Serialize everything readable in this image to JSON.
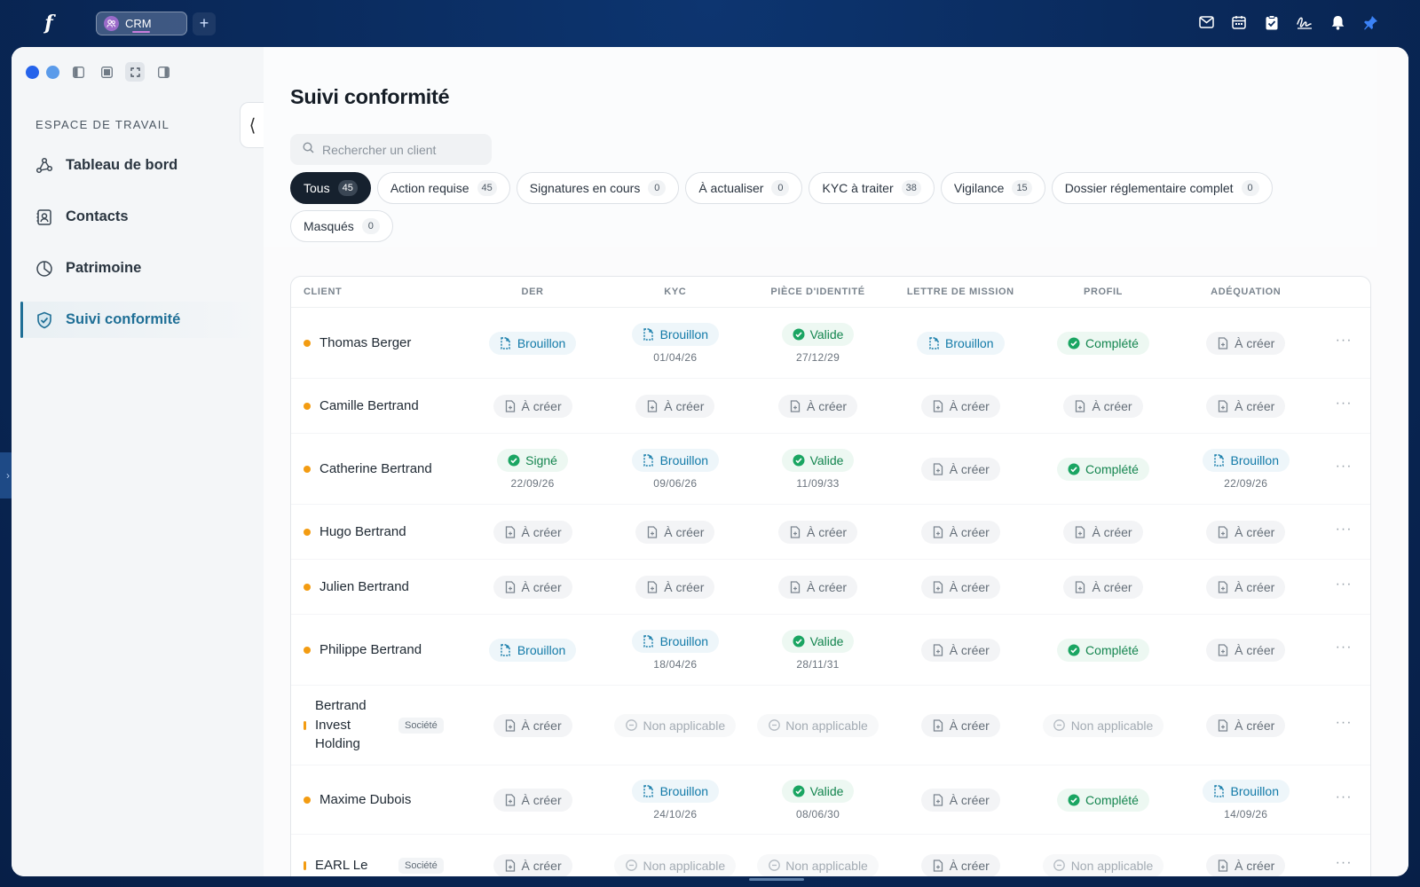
{
  "app": {
    "tab_label": "CRM",
    "add_tab": "+"
  },
  "colors": {
    "accent": "#1f6f96",
    "draft": "#127aa8",
    "valid": "#14854f",
    "warning_dot": "#f39c12",
    "window_dot_1": "#2563eb",
    "window_dot_2": "#5b9bea"
  },
  "topbar_icons": [
    "mail-icon",
    "calendar-icon",
    "clipboard-check-icon",
    "signature-icon",
    "bell-icon",
    "pin-icon"
  ],
  "sidebar": {
    "section_title": "ESPACE DE TRAVAIL",
    "collapse_glyph": "⟨",
    "items": [
      {
        "label": "Tableau de bord",
        "icon": "graph-icon"
      },
      {
        "label": "Contacts",
        "icon": "contacts-icon"
      },
      {
        "label": "Patrimoine",
        "icon": "pie-chart-icon"
      },
      {
        "label": "Suivi conformité",
        "icon": "shield-check-icon",
        "active": true
      }
    ]
  },
  "page": {
    "title": "Suivi conformité"
  },
  "search": {
    "placeholder": "Rechercher un client"
  },
  "filters": [
    {
      "label": "Tous",
      "count": "45",
      "active": true
    },
    {
      "label": "Action requise",
      "count": "45"
    },
    {
      "label": "Signatures en cours",
      "count": "0"
    },
    {
      "label": "À actualiser",
      "count": "0"
    },
    {
      "label": "KYC à traiter",
      "count": "38"
    },
    {
      "label": "Vigilance",
      "count": "15"
    },
    {
      "label": "Dossier réglementaire complet",
      "count": "0"
    },
    {
      "label": "Masqués",
      "count": "0"
    }
  ],
  "table": {
    "columns": [
      "CLIENT",
      "DER",
      "KYC",
      "PIÈCE D'IDENTITÉ",
      "LETTRE DE MISSION",
      "PROFIL",
      "ADÉQUATION"
    ],
    "rows": [
      {
        "client": "Thomas Berger",
        "cells": [
          [
            "draft",
            "Brouillon",
            ""
          ],
          [
            "draft",
            "Brouillon",
            "01/04/26"
          ],
          [
            "valid",
            "Valide",
            "27/12/29"
          ],
          [
            "draft",
            "Brouillon",
            ""
          ],
          [
            "valid",
            "Complété",
            ""
          ],
          [
            "create",
            "À créer",
            ""
          ]
        ]
      },
      {
        "client": "Camille Bertrand",
        "cells": [
          [
            "create",
            "À créer",
            ""
          ],
          [
            "create",
            "À créer",
            ""
          ],
          [
            "create",
            "À créer",
            ""
          ],
          [
            "create",
            "À créer",
            ""
          ],
          [
            "create",
            "À créer",
            ""
          ],
          [
            "create",
            "À créer",
            ""
          ]
        ]
      },
      {
        "client": "Catherine Bertrand",
        "cells": [
          [
            "valid",
            "Signé",
            "22/09/26"
          ],
          [
            "draft",
            "Brouillon",
            "09/06/26"
          ],
          [
            "valid",
            "Valide",
            "11/09/33"
          ],
          [
            "create",
            "À créer",
            ""
          ],
          [
            "valid",
            "Complété",
            ""
          ],
          [
            "draft",
            "Brouillon",
            "22/09/26"
          ]
        ]
      },
      {
        "client": "Hugo Bertrand",
        "cells": [
          [
            "create",
            "À créer",
            ""
          ],
          [
            "create",
            "À créer",
            ""
          ],
          [
            "create",
            "À créer",
            ""
          ],
          [
            "create",
            "À créer",
            ""
          ],
          [
            "create",
            "À créer",
            ""
          ],
          [
            "create",
            "À créer",
            ""
          ]
        ]
      },
      {
        "client": "Julien Bertrand",
        "cells": [
          [
            "create",
            "À créer",
            ""
          ],
          [
            "create",
            "À créer",
            ""
          ],
          [
            "create",
            "À créer",
            ""
          ],
          [
            "create",
            "À créer",
            ""
          ],
          [
            "create",
            "À créer",
            ""
          ],
          [
            "create",
            "À créer",
            ""
          ]
        ]
      },
      {
        "client": "Philippe Bertrand",
        "cells": [
          [
            "draft",
            "Brouillon",
            ""
          ],
          [
            "draft",
            "Brouillon",
            "18/04/26"
          ],
          [
            "valid",
            "Valide",
            "28/11/31"
          ],
          [
            "create",
            "À créer",
            ""
          ],
          [
            "valid",
            "Complété",
            ""
          ],
          [
            "create",
            "À créer",
            ""
          ]
        ]
      },
      {
        "client": "Bertrand Invest Holding",
        "tag": "Société",
        "cells": [
          [
            "create",
            "À créer",
            ""
          ],
          [
            "na",
            "Non applicable",
            ""
          ],
          [
            "na",
            "Non applicable",
            ""
          ],
          [
            "create",
            "À créer",
            ""
          ],
          [
            "na",
            "Non applicable",
            ""
          ],
          [
            "create",
            "À créer",
            ""
          ]
        ]
      },
      {
        "client": "Maxime Dubois",
        "cells": [
          [
            "create",
            "À créer",
            ""
          ],
          [
            "draft",
            "Brouillon",
            "24/10/26"
          ],
          [
            "valid",
            "Valide",
            "08/06/30"
          ],
          [
            "create",
            "À créer",
            ""
          ],
          [
            "valid",
            "Complété",
            ""
          ],
          [
            "draft",
            "Brouillon",
            "14/09/26"
          ]
        ]
      },
      {
        "client": "EARL Le",
        "tag": "Société",
        "cells": [
          [
            "create",
            "À créer",
            ""
          ],
          [
            "na",
            "Non applicable",
            ""
          ],
          [
            "na",
            "Non applicable",
            ""
          ],
          [
            "create",
            "À créer",
            ""
          ],
          [
            "na",
            "Non applicable",
            ""
          ],
          [
            "create",
            "À créer",
            ""
          ]
        ]
      }
    ],
    "row_action": "···"
  }
}
